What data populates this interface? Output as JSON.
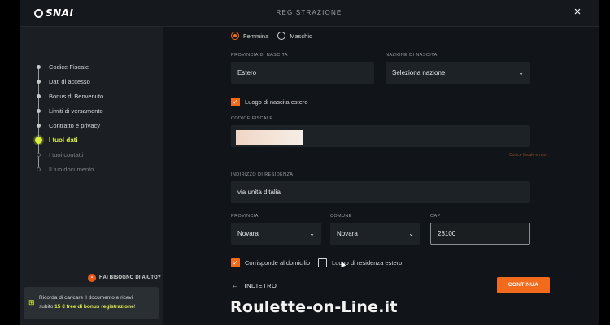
{
  "header": {
    "logo_text": "SNAI",
    "title": "REGISTRAZIONE",
    "close_icon": "×"
  },
  "sidebar": {
    "steps": [
      {
        "label": "Codice Fiscale",
        "state": "done"
      },
      {
        "label": "Dati di accesso",
        "state": "done"
      },
      {
        "label": "Bonus di Benvenuto",
        "state": "done"
      },
      {
        "label": "Limiti di versamento",
        "state": "done"
      },
      {
        "label": "Contratto e privacy",
        "state": "done"
      },
      {
        "label": "I tuoi dati",
        "state": "active"
      },
      {
        "label": "I tuoi contatti",
        "state": "future"
      },
      {
        "label": "Il tuo documento",
        "state": "future"
      }
    ],
    "help_label": "HAI BISOGNO DI AIUTO?",
    "promo": {
      "line1": "Ricorda di caricare il documento e ricevi",
      "line2_prefix": "subito ",
      "line2_bold": "15 € free di bonus registrazione",
      "line2_suffix": "!"
    }
  },
  "form": {
    "gender": {
      "female": "Femmina",
      "male": "Maschio",
      "selected": "Femmina"
    },
    "provincia_nascita": {
      "label": "PROVINCIA DI NASCITA",
      "value": "Estero"
    },
    "nazione_nascita": {
      "label": "NAZIONE DI NASCITA",
      "value": "Seleziona nazione"
    },
    "luogo_estero": {
      "label": "Luogo di nascita estero",
      "checked": true
    },
    "codice_fiscale": {
      "label": "CODICE FISCALE",
      "hint": "Codice fiscale errato"
    },
    "indirizzo": {
      "label": "INDIRIZZO DI RESIDENZA",
      "value": "via unita ditalia"
    },
    "provincia": {
      "label": "PROVINCIA",
      "value": "Novara"
    },
    "comune": {
      "label": "COMUNE",
      "value": "Novara"
    },
    "cap": {
      "label": "CAP",
      "value": "28100"
    },
    "corrisponde_domicilio": {
      "label": "Corrisponde al domicilio",
      "checked": true
    },
    "residenza_estero": {
      "label": "Luogo di residenza estero",
      "checked": false
    }
  },
  "actions": {
    "back_label": "INDIETRO",
    "continue_label": "CONTINUA"
  },
  "watermark": "Roulette-on-Line.it",
  "colors": {
    "accent_orange": "#f26a1b",
    "active_step_yellow": "#d8f03c",
    "background": "#111418",
    "sidebar": "#1b1f23"
  }
}
